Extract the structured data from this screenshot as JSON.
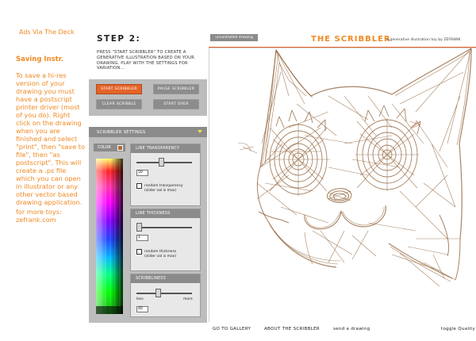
{
  "left": {
    "ads_link": "Ads Via The Deck",
    "saving_title": "Saving Instr.",
    "saving_body": "To save a hi-res version of your drawing you must have a postscript printer driver (most of you do). Right click on the drawing when you are finished and select \"print\", then \"save to file\", then \"as postscript\". This will create a .ps file which you can open in illustrator or any other vector based drawing application.",
    "more_toys_label": "for more toys:",
    "more_toys_link": "zefrank.com"
  },
  "step": {
    "title": "STEP 2:",
    "instructions": "PRESS \"START SCRIBBLER\" TO CREATE A GENERATIVE ILLUSTRATION BASED ON YOUR DRAWING. PLAY WITH THE SETTINGS FOR VARIATION..."
  },
  "buttons": {
    "start": "START SCRIBBLER",
    "pause": "PAUSE SCRIBBLER",
    "clear": "CLEAR SCRIBBLE",
    "start_over": "START OVER"
  },
  "settings": {
    "header": "SCRIBBLER SETTINGS",
    "color_label": "COLOR",
    "line_transparency": {
      "label": "LINE TRANSPARENCY",
      "value": "50",
      "level": 0.45,
      "random_label_1": "random transparency",
      "random_label_2": "(slider val is max)"
    },
    "line_thickness": {
      "label": "LINE THICKNESS",
      "value": "1",
      "level": 0.0,
      "random_label_1": "random thickness",
      "random_label_2": "(slider val is max)"
    },
    "scribbliness": {
      "label": "SCRIBBLINESS",
      "value": "40",
      "level": 0.38,
      "less_label": "less",
      "more_label": "more"
    }
  },
  "canvas": {
    "hide_button": "uncontrolled drawing",
    "app_title": "THE SCRIBBLER",
    "app_subtitle": "a generative illustration toy by ZEFRANK"
  },
  "footer": {
    "gallery": "GO TO GALLERY",
    "about": "ABOUT THE SCRIBBLER",
    "send": "send a drawing",
    "quality": "toggle Quality"
  },
  "colors": {
    "accent": "#f08a24",
    "button_orange": "#e4642a",
    "panel_gray": "#bdbdbd",
    "header_gray": "#8b8b8b",
    "scribble_brown": "#8a5a2e"
  }
}
